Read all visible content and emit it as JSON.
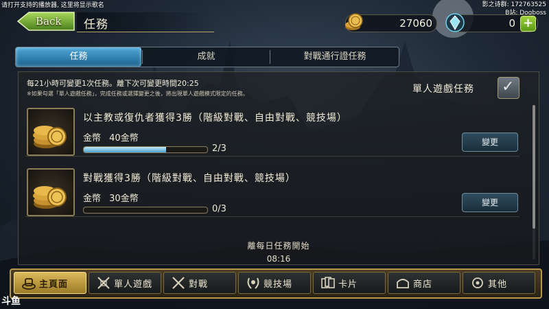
{
  "overlay": {
    "top_left": "请打开支持的播放器, 这里将显示歌名",
    "top_right_line1": "影之诗群: 172763525",
    "top_right_line2": "B站: Dogboss"
  },
  "header": {
    "back_label": "Back",
    "title": "任務",
    "gold": "27060",
    "gems": "0",
    "plus": "+"
  },
  "tabs": [
    {
      "label": "任務",
      "active": true
    },
    {
      "label": "成就",
      "active": false
    },
    {
      "label": "對戰通行證任務",
      "active": false
    }
  ],
  "panel": {
    "reset_text": "每21小時可變更1次任務。離下次可變更時間20:25",
    "reset_note": "※如果勾選「單人遊戲任務」，完成任務或選擇變更之後，將出現單人遊戲模式限定的任務。",
    "solo_label": "單人遊戲任務",
    "solo_checked": true,
    "missions": [
      {
        "title": "以主教或復仇者獲得3勝（階級對戰、自由對戰、競技場）",
        "reward_label": "金幣",
        "reward_value": "40金幣",
        "progress": 0.6667,
        "count": "2/3",
        "change_label": "變更"
      },
      {
        "title": "對戰獲得3勝（階級對戰、自由對戰、競技場）",
        "reward_label": "金幣",
        "reward_value": "30金幣",
        "progress": 0,
        "count": "0/3",
        "change_label": "變更"
      }
    ],
    "footer_label": "離每日任務開始",
    "footer_time": "08:16"
  },
  "bottom_nav": [
    {
      "label": "主頁面",
      "icon": "home-icon",
      "active": true
    },
    {
      "label": "單人遊戲",
      "icon": "crossed-swords-book-icon",
      "active": false
    },
    {
      "label": "對戰",
      "icon": "crossed-swords-icon",
      "active": false
    },
    {
      "label": "競技場",
      "icon": "laurel-icon",
      "active": false
    },
    {
      "label": "卡片",
      "icon": "cards-icon",
      "active": false
    },
    {
      "label": "商店",
      "icon": "shop-icon",
      "active": false
    },
    {
      "label": "其他",
      "icon": "other-icon",
      "active": false
    }
  ],
  "corner_logo": "斗鱼",
  "colors": {
    "accent_blue": "#4aa1cf",
    "gold_border": "#b8974c",
    "active_nav": "#d9b95a"
  }
}
